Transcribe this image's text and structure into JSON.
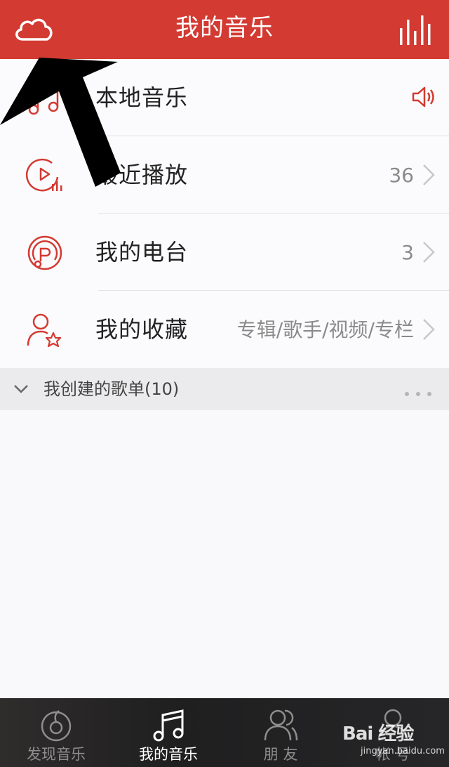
{
  "header": {
    "title": "我的音乐",
    "left_icon": "cloud-icon",
    "right_icon": "equalizer-bars-icon",
    "brand_color": "#d33a32"
  },
  "rows": [
    {
      "label": "本地音乐",
      "meta": "",
      "icon": "music-notes-icon",
      "trailing": "speaker-icon"
    },
    {
      "label": "最近播放",
      "meta": "36",
      "icon": "recent-play-icon",
      "trailing": "chevron-right-icon"
    },
    {
      "label": "我的电台",
      "meta": "3",
      "icon": "radio-icon",
      "trailing": "chevron-right-icon"
    },
    {
      "label": "我的收藏",
      "meta": "专辑/歌手/视频/专栏",
      "icon": "favorites-icon",
      "trailing": "chevron-right-icon"
    }
  ],
  "playlist_section": {
    "label": "我创建的歌单(10)",
    "icon": "chevron-down-icon",
    "more_icon": "more-dots-icon"
  },
  "tabbar": {
    "tabs": [
      {
        "label": "发现音乐",
        "icon": "discover-icon",
        "active": false
      },
      {
        "label": "我的音乐",
        "icon": "music-note-icon",
        "active": true
      },
      {
        "label": "朋 友",
        "icon": "friends-icon",
        "active": false
      },
      {
        "label": "帐 号",
        "icon": "account-icon",
        "active": false
      }
    ]
  },
  "watermark": {
    "main": "Bai 经验",
    "sub": "jingyan.baidu.com"
  }
}
